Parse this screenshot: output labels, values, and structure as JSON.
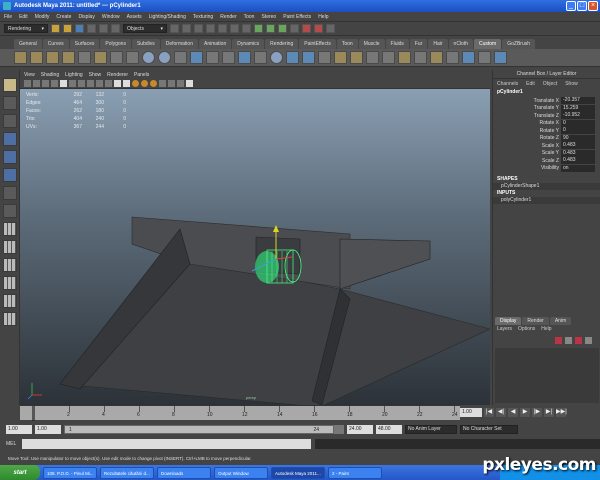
{
  "window": {
    "title": "Autodesk Maya 2011: untitled*   ---   pCylinder1"
  },
  "menubar": [
    "File",
    "Edit",
    "Modify",
    "Create",
    "Display",
    "Window",
    "Assets",
    "Lighting/Shading",
    "Texturing",
    "Render",
    "Toon",
    "Stereo",
    "Paint Effects",
    "Help"
  ],
  "statusline": {
    "mode": "Rendering",
    "select_mode": "Objects"
  },
  "shelf": {
    "tabs": [
      "General",
      "Curves",
      "Surfaces",
      "Polygons",
      "Subdivs",
      "Deformation",
      "Animation",
      "Dynamics",
      "Rendering",
      "PaintEffects",
      "Toon",
      "Muscle",
      "Fluids",
      "Fur",
      "Hair",
      "nCloth",
      "Custom",
      "GoZBrush"
    ],
    "active": "Custom"
  },
  "panel": {
    "menus": [
      "View",
      "Shading",
      "Lighting",
      "Show",
      "Renderer",
      "Panels"
    ],
    "hud": [
      {
        "label": "Verts:",
        "a": "292",
        "b": "132",
        "c": "0"
      },
      {
        "label": "Edges:",
        "a": "464",
        "b": "300",
        "c": "0"
      },
      {
        "label": "Faces:",
        "a": "262",
        "b": "180",
        "c": "0"
      },
      {
        "label": "Tris:",
        "a": "404",
        "b": "240",
        "c": "0"
      },
      {
        "label": "UVs:",
        "a": "367",
        "b": "244",
        "c": "0"
      }
    ],
    "camera": "persp"
  },
  "channelbox": {
    "title": "Channel Box / Layer Editor",
    "menus": [
      "Channels",
      "Edit",
      "Object",
      "Show"
    ],
    "object": "pCylinder1",
    "attrs": [
      {
        "name": "Translate X",
        "value": "-20.357"
      },
      {
        "name": "Translate Y",
        "value": "15.259"
      },
      {
        "name": "Translate Z",
        "value": "-10.952"
      },
      {
        "name": "Rotate X",
        "value": "0"
      },
      {
        "name": "Rotate Y",
        "value": "0"
      },
      {
        "name": "Rotate Z",
        "value": "90"
      },
      {
        "name": "Scale X",
        "value": "0.483"
      },
      {
        "name": "Scale Y",
        "value": "0.483"
      },
      {
        "name": "Scale Z",
        "value": "0.483"
      },
      {
        "name": "Visibility",
        "value": "on"
      }
    ],
    "shapes_label": "SHAPES",
    "shape": "pCylinderShape1",
    "inputs_label": "INPUTS",
    "input": "polyCylinder1"
  },
  "layers": {
    "tabs": [
      "Display",
      "Render",
      "Anim"
    ],
    "active": "Display",
    "menus": [
      "Layers",
      "Options",
      "Help"
    ]
  },
  "timeslider": {
    "ticks": [
      "2",
      "4",
      "6",
      "8",
      "10",
      "12",
      "14",
      "16",
      "18",
      "20",
      "22",
      "24"
    ],
    "current_frame": "1.00",
    "playback_buttons": [
      "|◀",
      "◀|",
      "◀",
      "▶",
      "|▶",
      "▶|",
      "▶▶|"
    ]
  },
  "range": {
    "start": "1.00",
    "inner_start": "1.00",
    "slider_lo": "1",
    "slider_hi": "24",
    "end": "24.00",
    "outer_end": "48.00",
    "anim_layer": "No Anim Layer",
    "char_set": "No Character Set"
  },
  "cmdline": {
    "label": "MEL"
  },
  "helpline": "Move Tool: Use manipulator to move object(s). Use edit mode to change pivot (INSERT). Ctrl+LMB to move perpendicular.",
  "taskbar": {
    "start": "start",
    "items": [
      "108. P.O.D. - Pinul Mi...",
      "Rezultatele căutării d...",
      "Downloads",
      "Output Window",
      "Autodesk Maya 2011...",
      "2 - Paint"
    ],
    "active_index": 4
  },
  "watermark": "pxleyes.com"
}
